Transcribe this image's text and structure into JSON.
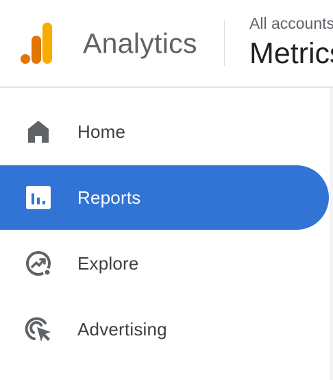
{
  "header": {
    "app_name": "Analytics",
    "account_line": "All accounts",
    "property_name": "Metrics"
  },
  "sidebar": {
    "items": [
      {
        "label": "Home",
        "icon": "home-icon",
        "active": false
      },
      {
        "label": "Reports",
        "icon": "reports-icon",
        "active": true
      },
      {
        "label": "Explore",
        "icon": "explore-icon",
        "active": false
      },
      {
        "label": "Advertising",
        "icon": "advertising-icon",
        "active": false
      }
    ]
  },
  "colors": {
    "active_bg": "#3273d6",
    "logo_orange": "#e37400",
    "logo_yellow": "#f9ab00",
    "icon_gray": "#5f6368"
  }
}
